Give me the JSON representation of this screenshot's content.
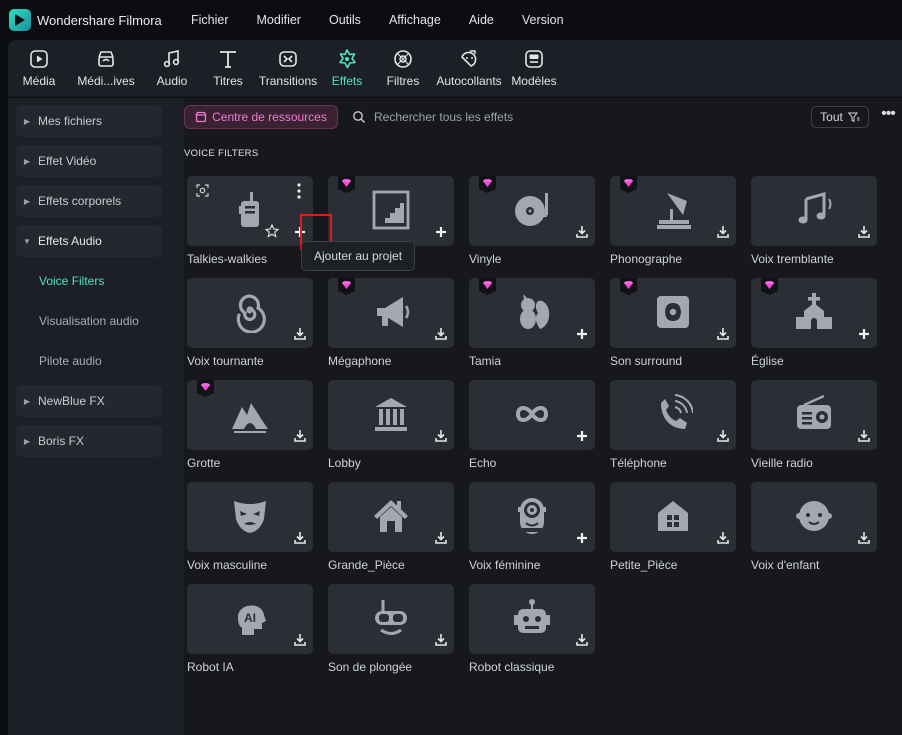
{
  "app": {
    "title": "Wondershare Filmora"
  },
  "menu": [
    "Fichier",
    "Modifier",
    "Outils",
    "Affichage",
    "Aide",
    "Version"
  ],
  "toolbar": [
    {
      "label": "Média",
      "icon": "media-icon"
    },
    {
      "label": "Médi...ives",
      "icon": "stock-media-icon"
    },
    {
      "label": "Audio",
      "icon": "audio-icon"
    },
    {
      "label": "Titres",
      "icon": "titles-icon"
    },
    {
      "label": "Transitions",
      "icon": "transitions-icon"
    },
    {
      "label": "Effets",
      "icon": "effects-icon",
      "active": true
    },
    {
      "label": "Filtres",
      "icon": "filters-icon"
    },
    {
      "label": "Autocollants",
      "icon": "stickers-icon"
    },
    {
      "label": "Modèles",
      "icon": "templates-icon"
    }
  ],
  "sidebar": {
    "items": [
      {
        "label": "Mes fichiers"
      },
      {
        "label": "Effet Vidéo"
      },
      {
        "label": "Effets corporels"
      },
      {
        "label": "Effets Audio",
        "expanded": true
      }
    ],
    "subitems": [
      {
        "label": "Voice Filters",
        "active": true
      },
      {
        "label": "Visualisation audio"
      },
      {
        "label": "Pilote audio"
      }
    ],
    "items_after": [
      {
        "label": "NewBlue FX"
      },
      {
        "label": "Boris FX"
      }
    ]
  },
  "search": {
    "resource_button": "Centre de ressources",
    "placeholder": "Rechercher tous les effets",
    "filter_label": "Tout",
    "more": "•••"
  },
  "section_title": "VOICE FILTERS",
  "tooltip": "Ajouter au projet",
  "colors": {
    "accent": "#4fe3c7",
    "premium": "#f04ad8",
    "highlight": "#e11b22"
  },
  "effects": [
    {
      "label": "Talkies-walkies",
      "icon": "walkie-talkie-icon",
      "premium": false,
      "action": "add"
    },
    {
      "label": "",
      "icon": "stairs-icon",
      "premium": true,
      "action": "add"
    },
    {
      "label": "Vinyle",
      "icon": "vinyl-icon",
      "premium": true,
      "action": "download"
    },
    {
      "label": "Phonographe",
      "icon": "phonograph-icon",
      "premium": true,
      "action": "download"
    },
    {
      "label": "Voix tremblante",
      "icon": "music-note-icon",
      "premium": false,
      "action": "download"
    },
    {
      "label": "Voix tournante",
      "icon": "spiral-icon",
      "premium": false,
      "action": "download"
    },
    {
      "label": "Mégaphone",
      "icon": "megaphone-icon",
      "premium": true,
      "action": "download"
    },
    {
      "label": "Tamia",
      "icon": "squirrel-icon",
      "premium": true,
      "action": "add"
    },
    {
      "label": "Son surround",
      "icon": "speaker-icon",
      "premium": true,
      "action": "download"
    },
    {
      "label": "Église",
      "icon": "church-icon",
      "premium": true,
      "action": "add"
    },
    {
      "label": "Grotte",
      "icon": "cave-icon",
      "premium": true,
      "action": "download"
    },
    {
      "label": "Lobby",
      "icon": "building-icon",
      "premium": false,
      "action": "download"
    },
    {
      "label": "Echo",
      "icon": "infinity-icon",
      "premium": false,
      "action": "add"
    },
    {
      "label": "Téléphone",
      "icon": "phone-icon",
      "premium": false,
      "action": "download"
    },
    {
      "label": "Vieille radio",
      "icon": "radio-icon",
      "premium": false,
      "action": "download"
    },
    {
      "label": "Voix masculine",
      "icon": "mask-icon",
      "premium": false,
      "action": "download"
    },
    {
      "label": "Grande_Pièce",
      "icon": "house-icon",
      "premium": false,
      "action": "download"
    },
    {
      "label": "Voix féminine",
      "icon": "minion-icon",
      "premium": false,
      "action": "add"
    },
    {
      "label": "Petite_Pièce",
      "icon": "small-house-icon",
      "premium": false,
      "action": "download"
    },
    {
      "label": "Voix d'enfant",
      "icon": "baby-icon",
      "premium": false,
      "action": "download"
    },
    {
      "label": "Robot IA",
      "icon": "ai-head-icon",
      "premium": false,
      "action": "download"
    },
    {
      "label": "Son de plongée",
      "icon": "diving-mask-icon",
      "premium": false,
      "action": "download"
    },
    {
      "label": "Robot classique",
      "icon": "robot-icon",
      "premium": false,
      "action": "download"
    }
  ]
}
